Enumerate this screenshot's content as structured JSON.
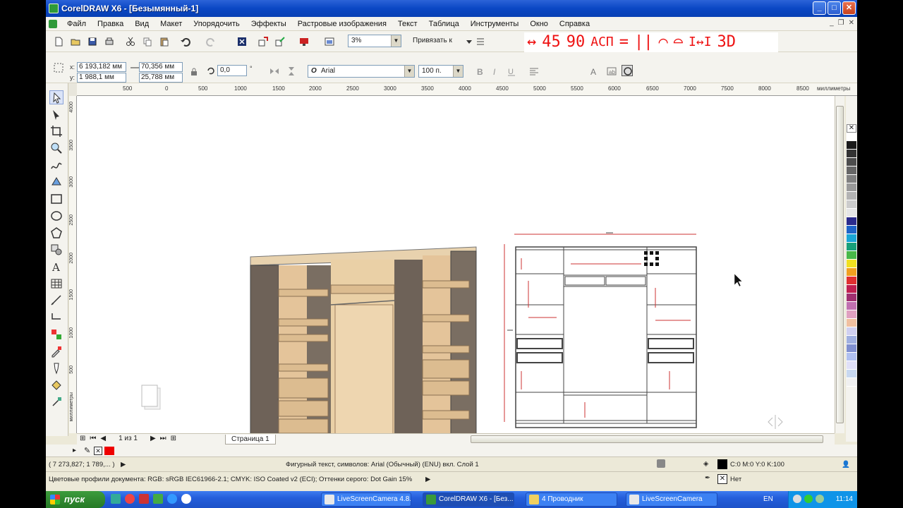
{
  "window": {
    "title": "CorelDRAW X6 - [Безымянный-1]"
  },
  "menu": {
    "items": [
      "Файл",
      "Правка",
      "Вид",
      "Макет",
      "Упорядочить",
      "Эффекты",
      "Растровые изображения",
      "Текст",
      "Таблица",
      "Инструменты",
      "Окно",
      "Справка"
    ]
  },
  "toolbar": {
    "zoom_value": "3%",
    "snap_label": "Привязать к",
    "custom_macros": [
      "↔",
      "45",
      "90",
      "АСП",
      "=",
      "||",
      "⌒",
      "⌓",
      "I↔I",
      "3D"
    ]
  },
  "property_bar": {
    "x_label": "x:",
    "y_label": "y:",
    "x_value": "6 193,182 мм",
    "y_value": "1 988,1 мм",
    "width_value": "70,356 мм",
    "height_value": "25,788 мм",
    "angle_value": "0,0",
    "angle_unit": "°",
    "font_name": "Arial",
    "font_size": "100 п."
  },
  "ruler": {
    "unit_label": "миллиметры",
    "h_ticks": [
      "500",
      "0",
      "500",
      "1000",
      "1500",
      "2000",
      "2500",
      "3000",
      "3500",
      "4000",
      "4500",
      "5000",
      "5500",
      "6000",
      "6500",
      "7000",
      "7500",
      "8000",
      "8500"
    ],
    "v_ticks": [
      "4000",
      "3500",
      "3000",
      "2500",
      "2000",
      "1500",
      "1000",
      "500",
      "миллиметры"
    ]
  },
  "page_nav": {
    "counter": "1 из 1",
    "tab_label": "Страница 1"
  },
  "status": {
    "cursor_coords": "( 7 273,827; 1 789,... )",
    "object_info": "Фигурный текст, символов: Arial (Обычный) (ENU) вкл. Слой 1",
    "fill_info": "C:0 M:0 Y:0 K:100",
    "outline_info": "Нет",
    "color_profiles": "Цветовые профили документа: RGB: sRGB IEC61966-2.1; CMYK: ISO Coated v2 (ECI); Оттенки серого: Dot Gain 15%"
  },
  "taskbar": {
    "start_label": "пуск",
    "tasks": [
      "LiveScreenCamera 4.8...",
      "CorelDRAW X6 - [Без...",
      "4 Проводник",
      "LiveScreenCamera"
    ],
    "lang": "EN",
    "clock": "11:14"
  },
  "palette": [
    "#ffffff",
    "#1a1a1a",
    "#333333",
    "#4d4d4d",
    "#666666",
    "#808080",
    "#999999",
    "#b3b3b3",
    "#cccccc",
    "#e6e6e6",
    "#2b2b8c",
    "#1e64c8",
    "#1aa6d6",
    "#18a07a",
    "#48b848",
    "#f0e020",
    "#f0a020",
    "#e03030",
    "#c02050",
    "#a03070",
    "#c070b0",
    "#e0a0c0",
    "#f0c0a0",
    "#d0d0f0",
    "#a0b0e0",
    "#8090d0",
    "#b0c0f0",
    "#e0e0f8",
    "#c8d8f0",
    "#f0f0f0"
  ]
}
